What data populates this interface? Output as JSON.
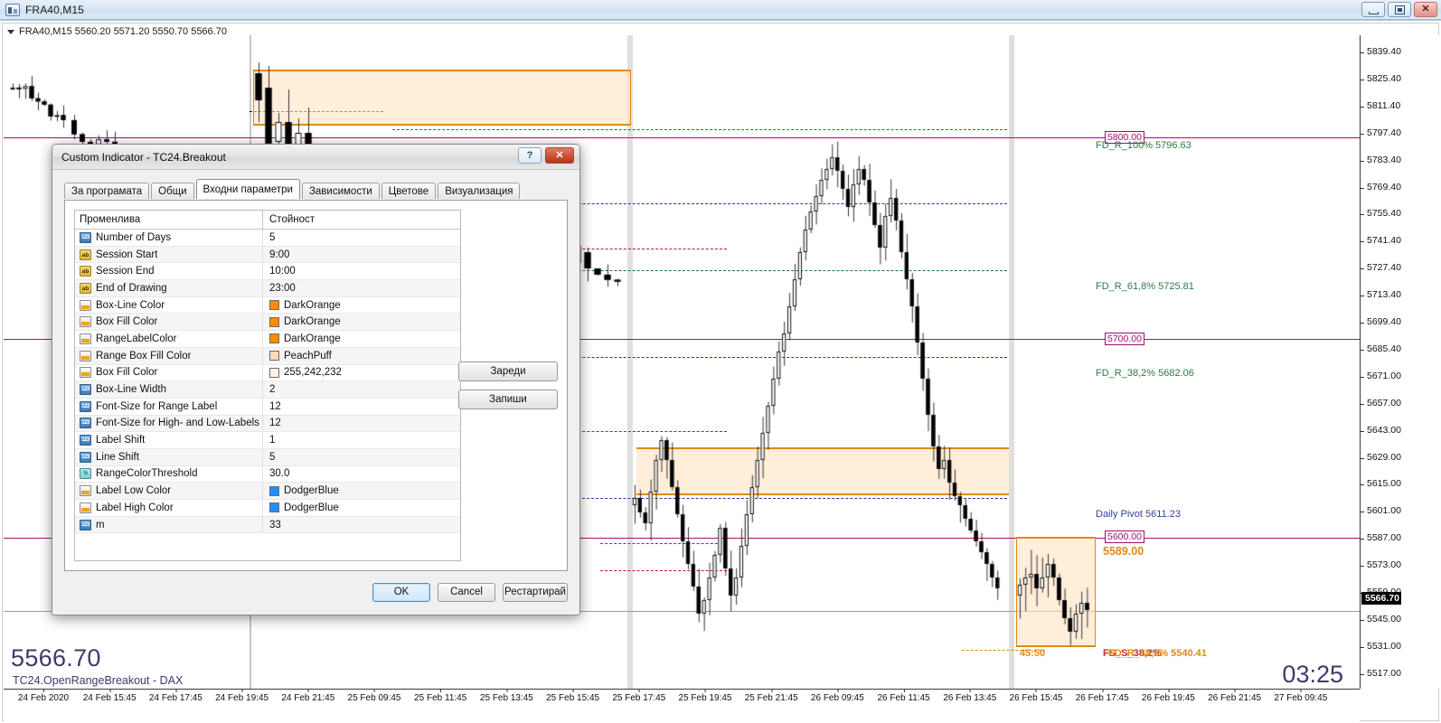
{
  "window": {
    "title": "FRA40,M15",
    "icon": "chart-icon",
    "minimize_label": "Minimize",
    "restore_label": "Restore",
    "close_label": "Close"
  },
  "chart": {
    "ohlc_header": "FRA40,M15  5560.20 5571.20 5550.70 5566.70",
    "symbol": "FRA40",
    "timeframe": "M15",
    "open": "5560.20",
    "high": "5571.20",
    "low": "5550.70",
    "close": "5566.70",
    "watermark_price": "5566.70",
    "watermark_sub": "TC24.OpenRangeBreakout - DAX",
    "clock": "03:25",
    "current_price": "5566.70",
    "price_ticks": [
      "5839.40",
      "5825.40",
      "5811.40",
      "5797.40",
      "5783.40",
      "5769.40",
      "5755.40",
      "5741.40",
      "5727.40",
      "5713.40",
      "5699.40",
      "5685.40",
      "5671.00",
      "5657.00",
      "5643.00",
      "5629.00",
      "5615.00",
      "5601.00",
      "5587.00",
      "5573.00",
      "5559.00",
      "5545.00",
      "5531.00",
      "5517.00"
    ],
    "time_ticks": [
      "24 Feb 2020",
      "24 Feb 15:45",
      "24 Feb 17:45",
      "24 Feb 19:45",
      "24 Feb 21:45",
      "25 Feb 09:45",
      "25 Feb 11:45",
      "25 Feb 13:45",
      "25 Feb 15:45",
      "25 Feb 17:45",
      "25 Feb 19:45",
      "25 Feb 21:45",
      "26 Feb 09:45",
      "26 Feb 11:45",
      "26 Feb 13:45",
      "26 Feb 15:45",
      "26 Feb 17:45",
      "26 Feb 19:45",
      "26 Feb 21:45",
      "27 Feb 09:45"
    ],
    "price_tags": [
      "5800.00",
      "5700.00",
      "5600.00"
    ],
    "annotations": {
      "fib_100": "FD_R_100% 5796.63",
      "fib_618": "FD_R_61,8% 5725.81",
      "fib_382": "FD_R_38,2% 5682.06",
      "daily_pivot": "Daily Pivot 5611.23",
      "range_high": "5589.00",
      "range_time": "45:50",
      "fib_bottom": "FD_R_38,2% 5540.41",
      "fib_bottom_overlap": "FS_S_38,2%"
    },
    "colors": {
      "range_box_fill": "#FFE4C4",
      "range_box_line": "#E08A14",
      "price_line": "#aa0e7f",
      "fib_text": "#2f7a46",
      "pivot_text": "#37409b",
      "watermark": "#3b3b6e"
    }
  },
  "dialog": {
    "title": "Custom Indicator - TC24.Breakout",
    "help_label": "?",
    "close_label": "✕",
    "tabs": [
      {
        "label": "За програмата",
        "active": false
      },
      {
        "label": "Общи",
        "active": false
      },
      {
        "label": "Входни параметри",
        "active": true
      },
      {
        "label": "Зависимости",
        "active": false
      },
      {
        "label": "Цветове",
        "active": false
      },
      {
        "label": "Визуализация",
        "active": false
      }
    ],
    "table": {
      "header": {
        "variable": "Променлива",
        "value": "Стойност"
      },
      "rows": [
        {
          "icon": "int-icon",
          "name": "Number of Days",
          "value": "5"
        },
        {
          "icon": "string-icon",
          "name": "Session Start",
          "value": "9:00"
        },
        {
          "icon": "string-icon",
          "name": "Session End",
          "value": "10:00"
        },
        {
          "icon": "string-icon",
          "name": "End of Drawing",
          "value": "23:00"
        },
        {
          "icon": "color-icon",
          "name": "Box-Line Color",
          "value": "DarkOrange",
          "swatch": "#FF8C00"
        },
        {
          "icon": "color-icon",
          "name": "Box Fill Color",
          "value": "DarkOrange",
          "swatch": "#FF8C00"
        },
        {
          "icon": "color-icon",
          "name": "RangeLabelColor",
          "value": "DarkOrange",
          "swatch": "#FF8C00"
        },
        {
          "icon": "color-icon",
          "name": "Range Box Fill Color",
          "value": "PeachPuff",
          "swatch": "#FFDAB9"
        },
        {
          "icon": "color-icon",
          "name": "Box Fill Color",
          "value": "255,242,232",
          "swatch": "#FFF2E8"
        },
        {
          "icon": "int-icon",
          "name": "Box-Line Width",
          "value": "2"
        },
        {
          "icon": "int-icon",
          "name": "Font-Size for Range Label",
          "value": "12"
        },
        {
          "icon": "int-icon",
          "name": "Font-Size for High- and Low-Labels",
          "value": "12"
        },
        {
          "icon": "int-icon",
          "name": "Label Shift",
          "value": "1"
        },
        {
          "icon": "int-icon",
          "name": "Line Shift",
          "value": "5"
        },
        {
          "icon": "double-icon",
          "name": "RangeColorThreshold",
          "value": "30.0"
        },
        {
          "icon": "color-icon",
          "name": "Label Low Color",
          "value": "DodgerBlue",
          "swatch": "#1E90FF"
        },
        {
          "icon": "color-icon",
          "name": "Label High Color",
          "value": "DodgerBlue",
          "swatch": "#1E90FF"
        },
        {
          "icon": "int-icon",
          "name": "m",
          "value": "33"
        }
      ]
    },
    "buttons": {
      "load": "Зареди",
      "save": "Запиши",
      "ok": "OK",
      "cancel": "Cancel",
      "reset": "Рестартирай"
    }
  }
}
